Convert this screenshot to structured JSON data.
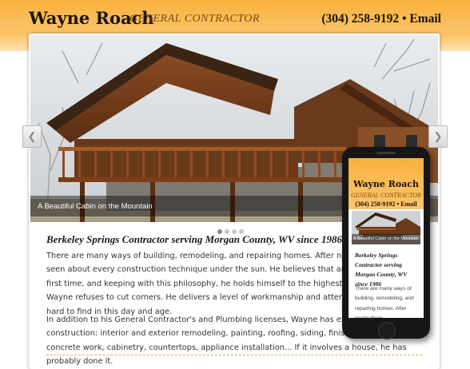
{
  "header": {
    "name": "Wayne Roach",
    "tagline": "GENERAL CONTRACTOR",
    "phone": "(304) 258-9192",
    "separator": "•",
    "email_label": "Email"
  },
  "slider": {
    "caption": "A Beautiful Cabin on the Mountain",
    "prev_icon": "chevron-left",
    "next_icon": "chevron-right",
    "dot_count": 4,
    "active_dot": 1
  },
  "main": {
    "headline": "Berkeley Springs Contractor serving Morgan County, WV since 1986",
    "paragraph1": "There are many ways of building, remodeling, and repairing homes. After nearly three decades seen about every construction technique under the sun. He believes that anything worth doing first time, and keeping with this philosophy, he holds himself to the highest standard of crafts Wayne refuses to cut corners. He delivers a level of workmanship and attention to detail that hard to find in this day and age.",
    "paragraph2": "In addition to his General Contractor's and Plumbing licenses, Wayne has experience in nearly construction: interior and exterior remodeling, painting, roofing, siding, finish carpentry, floor concrete work, cabinetry, countertops, appliance installation... If it involves a house, he has probably done it."
  },
  "phone_mockup": {
    "name": "Wayne Roach",
    "tagline": "GENERAL CONTRACTOR",
    "contact": "(304) 258-9192 • Email",
    "caption": "A Beautiful Cabin on the Mountain",
    "headline": "Berkeley Springs Contractor serving Morgan County, WV since 1986",
    "paragraph": "There are many ways of building, remodeling, and repairing homes. After nearly three"
  },
  "colors": {
    "header_orange": "#f9b13e",
    "accent_dash": "#e8a85a"
  }
}
